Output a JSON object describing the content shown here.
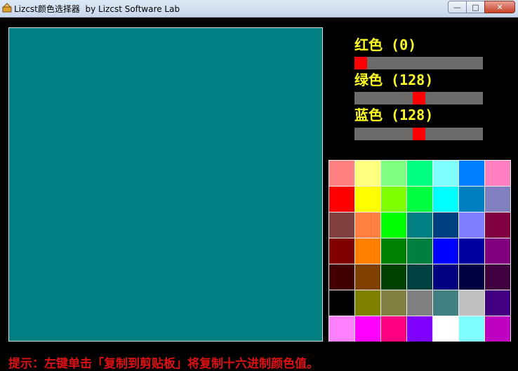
{
  "window": {
    "title": "Lizcst颜色选择器  by Lizcst Software Lab",
    "min_label": "—",
    "max_label": "□",
    "close_label": "✕"
  },
  "preview": {
    "color": "#008080"
  },
  "sliders": [
    {
      "label": "红色 (0)",
      "value": 0,
      "max": 255
    },
    {
      "label": "绿色 (128)",
      "value": 128,
      "max": 255
    },
    {
      "label": "蓝色 (128)",
      "value": 128,
      "max": 255
    }
  ],
  "palette": [
    "#ff8080",
    "#ffff80",
    "#80ff80",
    "#00ff80",
    "#80ffff",
    "#0080ff",
    "#ff80c0",
    "#ff0000",
    "#ffff00",
    "#80ff00",
    "#00ff40",
    "#00ffff",
    "#0080c0",
    "#8080c0",
    "#804040",
    "#ff8040",
    "#00ff00",
    "#008080",
    "#004080",
    "#8080ff",
    "#800040",
    "#800000",
    "#ff8000",
    "#008000",
    "#008040",
    "#0000ff",
    "#0000a0",
    "#800080",
    "#400000",
    "#804000",
    "#004000",
    "#004040",
    "#000080",
    "#000040",
    "#400040",
    "#000000",
    "#808000",
    "#808040",
    "#808080",
    "#408080",
    "#c0c0c0",
    "#400080",
    "#ff80ff",
    "#ff00ff",
    "#ff0080",
    "#8000ff",
    "#ffffff",
    "#80ffff",
    "#c000c0"
  ],
  "hint": "提示：左键单击「复制到剪贴板」将复制十六进制颜色值。"
}
